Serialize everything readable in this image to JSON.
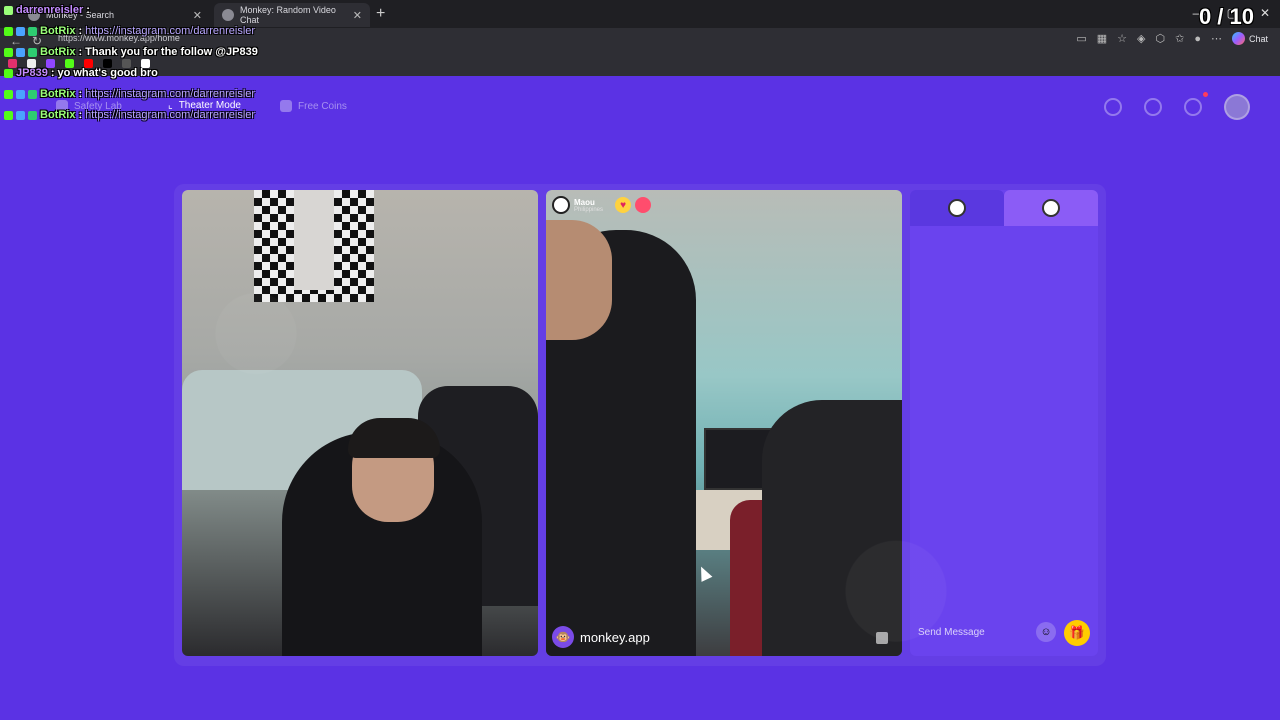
{
  "browser": {
    "tabs": [
      {
        "label": "Monkey - Search"
      },
      {
        "label": "Monkey: Random Video Chat"
      }
    ],
    "url": "https://www.monkey.app/home",
    "chat_label": "Chat"
  },
  "page": {
    "nav": [
      {
        "label": "Safety Lab"
      },
      {
        "label": "Theater Mode"
      },
      {
        "label": "Free Coins"
      }
    ],
    "peer": {
      "name": "Maou",
      "country": "Philippines"
    },
    "watermark": "monkey.app",
    "chat": {
      "placeholder": "Send Message"
    }
  },
  "overlay": {
    "streamer": "darrenreisler",
    "counter": "0 / 10",
    "lines": [
      {
        "user": "BotRix",
        "sep": " : ",
        "text": "https://instagram.com/darrenreisler",
        "link": true
      },
      {
        "user": "BotRix",
        "sep": " : ",
        "text": "Thank you for the follow @JP839",
        "link": false
      },
      {
        "user": "JP839",
        "sep": " : ",
        "text": "yo what's good bro",
        "link": false
      },
      {
        "user": "BotRix",
        "sep": " : ",
        "text": "https://instagram.com/darrenreisler",
        "link": true
      },
      {
        "user": "BotRix",
        "sep": " : ",
        "text": "https://instagram.com/darrenreisler",
        "link": true
      }
    ]
  },
  "colors": {
    "page_bg": "#5b32e4",
    "chat_panel": "#6a43ee",
    "bot_user": "#9bff7a",
    "viewer_user": "#c48cff",
    "link": "#b9a7ff"
  }
}
